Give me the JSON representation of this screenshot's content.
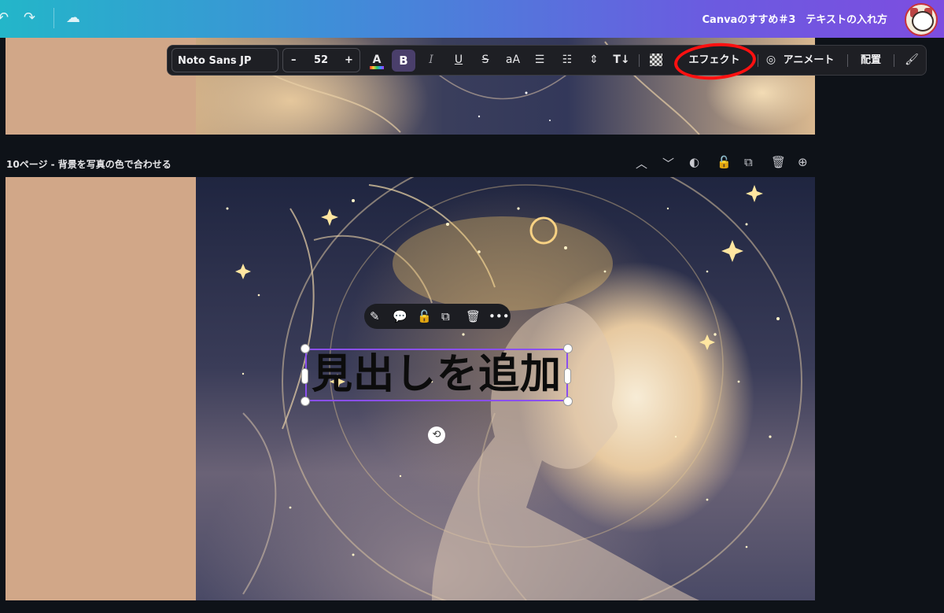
{
  "header": {
    "document_title": "Canvaのすすめ＃3　テキストの入れ方",
    "undo_icon": "undo-icon",
    "redo_icon": "redo-icon",
    "save_status_icon": "cloud-icon"
  },
  "toolbar": {
    "font_family": "Noto Sans JP",
    "font_size": "52",
    "decrease_label": "–",
    "increase_label": "+",
    "text_color_label": "A",
    "bold_label": "B",
    "italic_label": "I",
    "underline_label": "U",
    "strikethrough_label": "S",
    "case_label": "aA",
    "effects_label": "エフェクト",
    "animate_label": "アニメート",
    "position_label": "配置",
    "highlighted_item": "エフェクト"
  },
  "page": {
    "label": "10ページ - 背景を写真の色で合わせる"
  },
  "canvas": {
    "heading_text": "見出しを追加",
    "background_color": "#d1a788"
  },
  "colors": {
    "accent_selection": "#8a4ff0",
    "annotation_circle": "#ff1010",
    "toolbar_bg": "#1e1f24"
  }
}
